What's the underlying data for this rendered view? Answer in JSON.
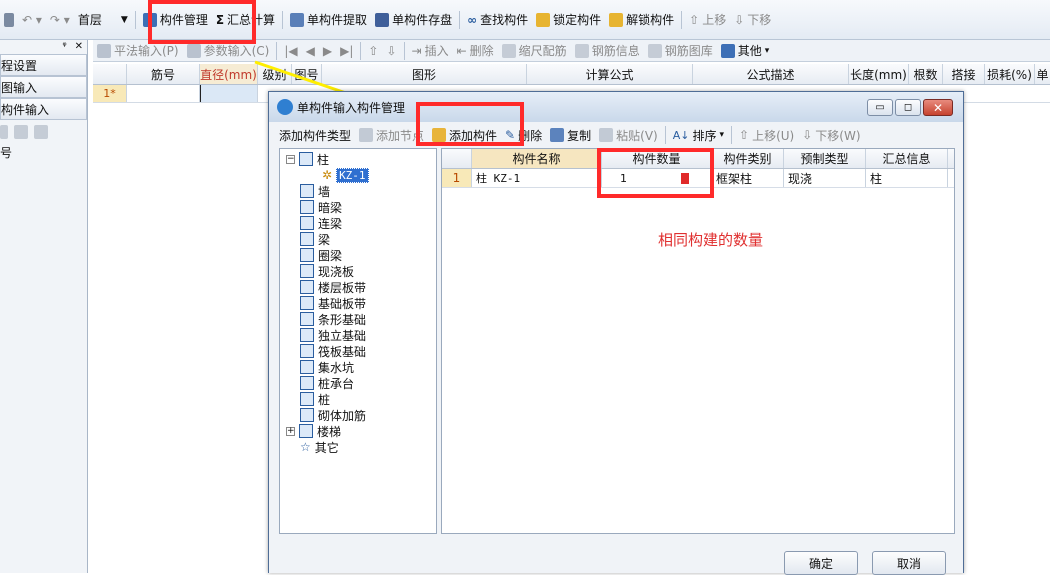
{
  "toolbar1": {
    "floor": "首层",
    "items": [
      "构件管理",
      "汇总计算",
      "单构件提取",
      "单构件存盘",
      "查找构件",
      "锁定构件",
      "解锁构件",
      "上移",
      "下移"
    ]
  },
  "toolbar2": {
    "items": [
      "平法输入(P)",
      "参数输入(C)",
      "插入",
      "删除",
      "缩尺配筋",
      "钢筋信息",
      "钢筋图库",
      "其他"
    ]
  },
  "left_panel": {
    "pin": "ᵠ",
    "close": "✕",
    "items": [
      "程设置",
      "图输入",
      "构件输入"
    ],
    "partial": "号"
  },
  "main_grid": {
    "headers": [
      "筋号",
      "直径(mm)",
      "级别",
      "图号",
      "图形",
      "计算公式",
      "公式描述",
      "长度(mm)",
      "根数",
      "搭接",
      "损耗(%)",
      "单"
    ],
    "row_label": "1*"
  },
  "dialog": {
    "title": "单构件输入构件管理",
    "toolbar": [
      "添加构件类型",
      "添加节点",
      "添加构件",
      "删除",
      "复制",
      "粘贴(V)",
      "排序",
      "上移(U)",
      "下移(W)"
    ],
    "tree": [
      "柱",
      "KZ-1",
      "墙",
      "暗梁",
      "连梁",
      "梁",
      "圈梁",
      "现浇板",
      "楼层板带",
      "基础板带",
      "条形基础",
      "独立基础",
      "筏板基础",
      "集水坑",
      "桩承台",
      "桩",
      "砌体加筋",
      "楼梯",
      "其它"
    ],
    "table_headers": [
      "构件名称",
      "构件数量",
      "构件类别",
      "预制类型",
      "汇总信息"
    ],
    "row": {
      "index": "1",
      "name": "柱 KZ-1",
      "qty": "1",
      "category": "框架柱",
      "prefab": "现浇",
      "summary": "柱"
    },
    "annotation": "相同构建的数量",
    "ok": "确定",
    "cancel": "取消"
  },
  "colors": {
    "accent_blue": "#2a5d9f",
    "highlight_red": "#ff2a2a",
    "arrow_yellow": "#ffee00",
    "annotation_red": "#e03030"
  }
}
